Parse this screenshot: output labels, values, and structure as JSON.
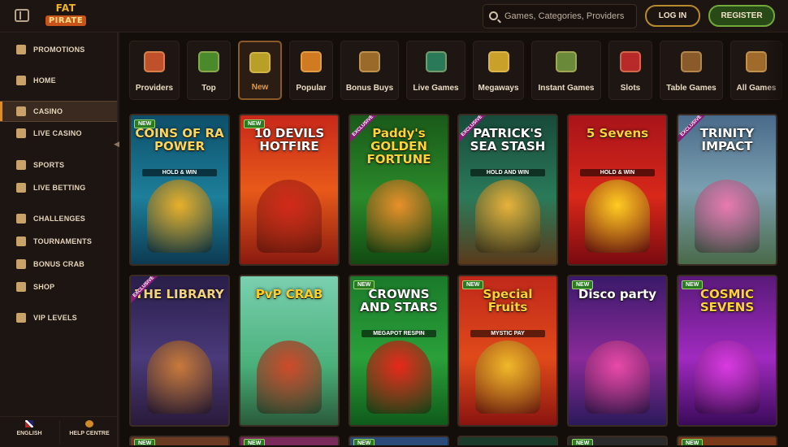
{
  "header": {
    "logo_line1": "FAT",
    "logo_line2": "PIRATE",
    "search_placeholder": "Games, Categories, Providers",
    "login_label": "LOG IN",
    "register_label": "REGISTER"
  },
  "sidebar": {
    "items": [
      {
        "label": "PROMOTIONS",
        "icon": "promotions-icon"
      },
      {
        "label": "HOME",
        "icon": "home-icon"
      },
      {
        "label": "CASINO",
        "icon": "casino-icon",
        "active": true
      },
      {
        "label": "LIVE CASINO",
        "icon": "live-casino-icon"
      },
      {
        "label": "SPORTS",
        "icon": "sports-icon"
      },
      {
        "label": "LIVE BETTING",
        "icon": "live-betting-icon"
      },
      {
        "label": "CHALLENGES",
        "icon": "challenges-icon"
      },
      {
        "label": "TOURNAMENTS",
        "icon": "trophy-icon"
      },
      {
        "label": "BONUS CRAB",
        "icon": "crab-icon"
      },
      {
        "label": "SHOP",
        "icon": "shop-icon"
      },
      {
        "label": "VIP LEVELS",
        "icon": "vip-icon"
      }
    ],
    "footer": {
      "language_label": "ENGLISH",
      "help_label": "HELP CENTRE"
    }
  },
  "categories": [
    {
      "label": "Providers",
      "icon": "providers-icon",
      "color": "#c0502a"
    },
    {
      "label": "Top",
      "icon": "star-icon",
      "color": "#4a8a2a"
    },
    {
      "label": "New",
      "icon": "trophy-icon",
      "color": "#b8a028",
      "active": true
    },
    {
      "label": "Popular",
      "icon": "crown-icon",
      "color": "#d07a22"
    },
    {
      "label": "Bonus Buys",
      "icon": "chest-icon",
      "color": "#9a6a2a"
    },
    {
      "label": "Live Games",
      "icon": "cards-icon",
      "color": "#2a7a5a"
    },
    {
      "label": "Megaways",
      "icon": "megaways-icon",
      "color": "#c8a02a"
    },
    {
      "label": "Instant Games",
      "icon": "joystick-icon",
      "color": "#6a8a3a"
    },
    {
      "label": "Slots",
      "icon": "cherries-icon",
      "color": "#b82a2a"
    },
    {
      "label": "Table Games",
      "icon": "roulette-icon",
      "color": "#8a5a2a"
    },
    {
      "label": "All Games",
      "icon": "chest-icon",
      "color": "#a06a2a"
    }
  ],
  "badges": {
    "new": "NEW",
    "exclusive": "EXCLUSIVE"
  },
  "games": [
    {
      "title": "COINS OF RA POWER",
      "sub": "HOLD & WIN",
      "badge": "new",
      "bg": "linear-gradient(180deg,#0e4f6a,#1d7f9a 55%,#0c3a52)",
      "fg": "#ffd45a",
      "art": "#e8b02a"
    },
    {
      "title": "10 DEVILS HOTFIRE",
      "sub": "",
      "badge": "new",
      "bg": "linear-gradient(180deg,#c8281a,#e85a1a 50%,#8a1a10)",
      "fg": "#ffffff",
      "art": "#d22a1a"
    },
    {
      "title": "Paddy's GOLDEN FORTUNE",
      "sub": "",
      "badge": "exclusive",
      "bg": "linear-gradient(180deg,#1a5a1a,#2a8a2a 55%,#124a12)",
      "fg": "#ffd23a",
      "art": "#e8902a"
    },
    {
      "title": "PATRICK'S SEA STASH",
      "sub": "HOLD AND WIN",
      "badge": "exclusive",
      "bg": "linear-gradient(180deg,#184a3a,#2a7a5a 55%,#5a3a1a)",
      "fg": "#ffffff",
      "art": "#e8b23a"
    },
    {
      "title": "5 Sevens",
      "sub": "HOLD & WIN",
      "badge": "",
      "bg": "linear-gradient(180deg,#a8141a,#d8281a 55%,#7a0a10)",
      "fg": "#ffd23a",
      "art": "#ffcc22"
    },
    {
      "title": "TRINITY IMPACT",
      "sub": "",
      "badge": "exclusive",
      "bg": "linear-gradient(180deg,#4a6a8a,#7aa0b0 50%,#4a6a4a)",
      "fg": "#ffffff",
      "art": "#e87ab0"
    },
    {
      "title": "THE LIBRARY",
      "sub": "",
      "badge": "exclusive",
      "bg": "linear-gradient(180deg,#2a1e4a,#4a3a7a 55%,#2a1a3a)",
      "fg": "#f2d27a",
      "art": "#c87a3a"
    },
    {
      "title": "PvP CRAB",
      "sub": "",
      "badge": "",
      "bg": "linear-gradient(180deg,#7ad0b0,#4ab07a 60%,#2a5a3a)",
      "fg": "#ffcc22",
      "art": "#d04a2a"
    },
    {
      "title": "CROWNS AND STARS",
      "sub": "MEGAPOT RESPIN",
      "badge": "new",
      "bg": "linear-gradient(180deg,#1a7a2a,#2aa03a 55%,#0f5a1a)",
      "fg": "#ffffff",
      "art": "#e8281a"
    },
    {
      "title": "Special Fruits",
      "sub": "MYSTIC PAY",
      "badge": "new",
      "bg": "linear-gradient(180deg,#c0281a,#e04a1a 55%,#8a1410)",
      "fg": "#ffd23a",
      "art": "#f0b82a"
    },
    {
      "title": "Disco party",
      "sub": "",
      "badge": "new",
      "bg": "linear-gradient(180deg,#3a1a6a,#8a2a9a 55%,#2a1a5a)",
      "fg": "#ffffff",
      "art": "#e84aa8"
    },
    {
      "title": "COSMIC SEVENS",
      "sub": "",
      "badge": "new",
      "bg": "linear-gradient(180deg,#5a1a7a,#a02ac0 55%,#3a0a5a)",
      "fg": "#ffd23a",
      "art": "#d83ae0"
    }
  ],
  "row3": [
    {
      "badge": "new",
      "bg": "#6a3a22"
    },
    {
      "badge": "new",
      "bg": "#7a2a5a"
    },
    {
      "badge": "new",
      "bg": "#2a4a7a"
    },
    {
      "badge": "",
      "bg": "#1a3a2a"
    },
    {
      "badge": "new",
      "bg": "#2a2a2a"
    },
    {
      "badge": "new",
      "bg": "#7a3a1a"
    }
  ]
}
